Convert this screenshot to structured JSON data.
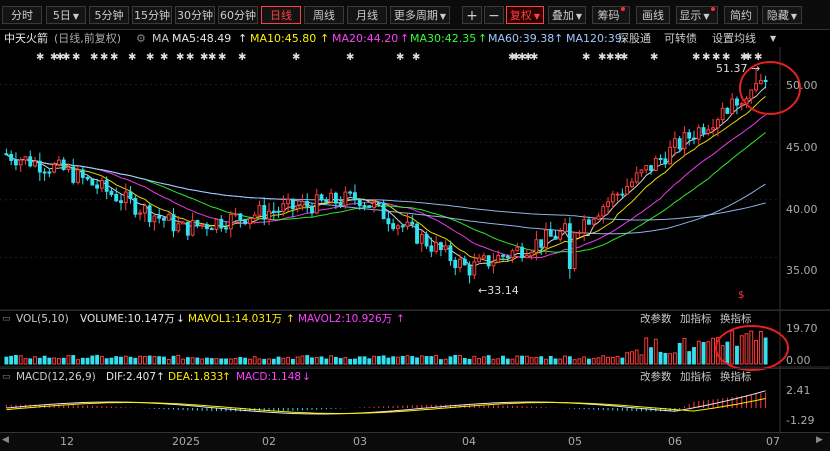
{
  "toolbar": {
    "tabs": [
      {
        "label": "分时"
      },
      {
        "label": "5日"
      },
      {
        "label": "5分钟"
      },
      {
        "label": "15分钟"
      },
      {
        "label": "30分钟"
      },
      {
        "label": "60分钟"
      },
      {
        "label": "日线",
        "active": true
      },
      {
        "label": "周线"
      },
      {
        "label": "月线"
      },
      {
        "label": "更多周期"
      }
    ],
    "plus": "+",
    "minus": "−",
    "fq": "复权",
    "overlay": "叠加",
    "chip": "筹码",
    "draw": "画线",
    "display": "显示",
    "simple": "简约",
    "hide": "隐藏"
  },
  "info": {
    "name": "中天火箭",
    "mode": "(日线,前复权)",
    "ma_label": "MA",
    "ma5": "MA5:48.49",
    "ma10": "MA10:45.80",
    "ma20": "MA20:44.20",
    "ma30": "MA30:42.35",
    "ma60": "MA60:39.38",
    "ma120": "MA120:39.",
    "sgt": "深股通",
    "convert": "可转债",
    "settings": "设置均线"
  },
  "colors": {
    "up": "#ff3b3b",
    "down": "#33e0f0",
    "ma5": "#e8e8e8",
    "ma10": "#ffee00",
    "ma20": "#ff40ff",
    "ma30": "#33ff33",
    "ma60": "#9ec8ff",
    "ma120": "#9ec8ff"
  },
  "price": {
    "ymin": 32,
    "ymax": 53,
    "ticks": [
      "50.00",
      "45.00",
      "40.00",
      "35.00"
    ],
    "high_label": "51.37",
    "low_label": "33.14",
    "marker": "$"
  },
  "volume": {
    "title": "VOL(5,10)",
    "vol": "VOLUME:10.147万",
    "mavol1": "MAVOL1:14.031万",
    "mavol2": "MAVOL2:10.926万",
    "params": "改参数",
    "add": "加指标",
    "switch": "换指标",
    "ticks": [
      "19.70",
      "0.00"
    ]
  },
  "macd": {
    "title": "MACD(12,26,9)",
    "dif": "DIF:2.407",
    "dea": "DEA:1.833",
    "macd": "MACD:1.148",
    "params": "改参数",
    "add": "加指标",
    "switch": "换指标",
    "ticks": [
      "2.41",
      "-1.29"
    ]
  },
  "xaxis": {
    "labels": [
      "12",
      "2025",
      "02",
      "03",
      "04",
      "05",
      "06",
      "07"
    ]
  },
  "chart_data": {
    "type": "candlestick",
    "title": "",
    "xlabel": "",
    "ylabel": "",
    "ylim": [
      32,
      53
    ],
    "x": [
      "12",
      "2025",
      "02",
      "03",
      "04",
      "05",
      "06",
      "07"
    ],
    "close_anchors": [
      {
        "x": "12",
        "close": 42.5
      },
      {
        "x": "2025",
        "close": 37.5
      },
      {
        "x": "02",
        "close": 39.0
      },
      {
        "x": "03",
        "close": 40.2
      },
      {
        "x": "04",
        "close": 34.0
      },
      {
        "x": "05",
        "close": 37.5
      },
      {
        "x": "06",
        "close": 44.5
      },
      {
        "x": "07",
        "close": 50.5
      }
    ],
    "price_high": 51.37,
    "price_low": 33.14,
    "indicators": {
      "MA5": 48.49,
      "MA10": 45.8,
      "MA20": 44.2,
      "MA30": 42.35,
      "MA60": 39.38,
      "VOLUME": "10.147万",
      "MAVOL1": "14.031万",
      "MAVOL2": "10.926万",
      "DIF": 2.407,
      "DEA": 1.833,
      "MACD": 1.148
    }
  }
}
